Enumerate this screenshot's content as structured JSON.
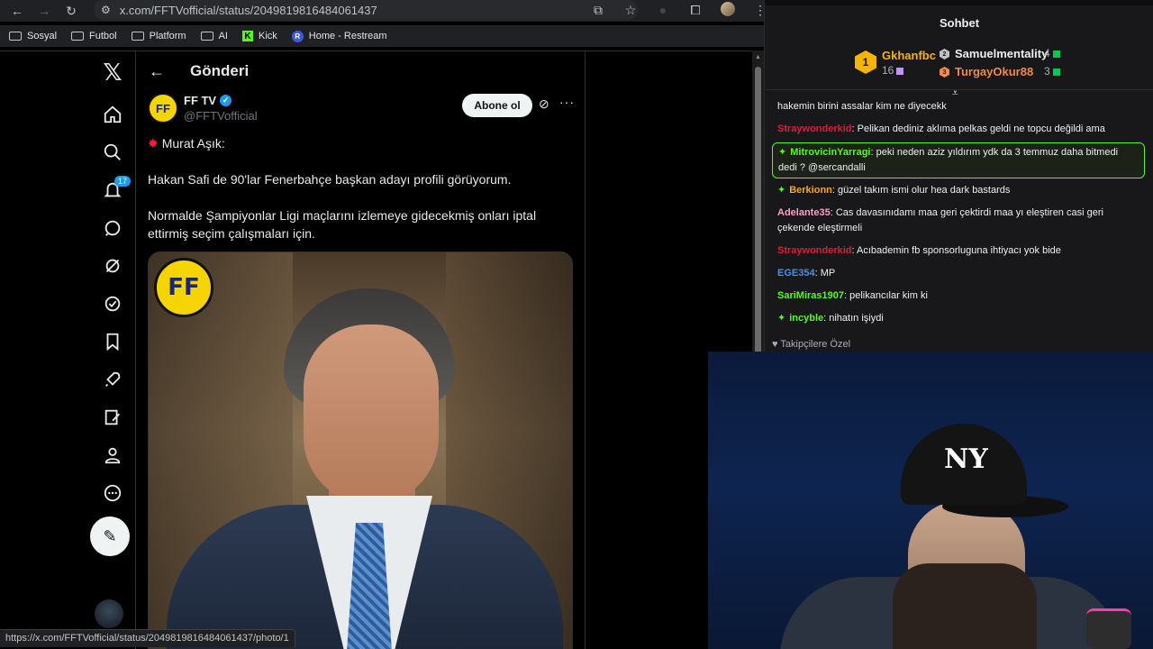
{
  "browser": {
    "url": "x.com/FFTVofficial/status/2049819816484061437",
    "status_url": "https://x.com/FFTVofficial/status/2049819816484061437/photo/1",
    "bookmarks": [
      "Sosyal",
      "Futbol",
      "Platform",
      "AI",
      "Kick",
      "Home - Restream"
    ]
  },
  "x": {
    "header_title": "Gönderi",
    "notification_count": "17",
    "author_name": "FF TV",
    "author_handle": "@FFTVofficial",
    "follow_label": "Abone ol",
    "tweet_line1": "Murat Aşık:",
    "tweet_line2": "Hakan Safi de 90'lar Fenerbahçe başkan adayı profili görüyorum.",
    "tweet_line3": "Normalde Şampiyonlar Ligi maçlarını izlemeye gidecekmiş onları iptal ettirmiş seçim çalışmaları için.",
    "media_logo": "FF"
  },
  "chat": {
    "title": "Sohbet",
    "leaderboard": [
      {
        "rank": "1",
        "name": "Gkhanfbc",
        "count": "16"
      },
      {
        "rank": "2",
        "name": "Samuelmentality",
        "count": "4"
      },
      {
        "rank": "3",
        "name": "TurgayOkur88",
        "count": "3"
      }
    ],
    "messages": [
      {
        "user": "",
        "text": "hakemin birini assalar kim ne diyecekk",
        "color": "#efeff1"
      },
      {
        "user": "Straywonderkid",
        "text": ": Pelikan dediniz aklıma pelkas geldi ne topcu değildi ama",
        "color": "#e01b3c"
      },
      {
        "user": "MitrovicinYarragi",
        "text": ": peki neden aziz yıldırım ydk da 3 temmuz daha bitmedi dedi ? @sercandalli",
        "color": "#53fc18"
      },
      {
        "user": "Berkionn",
        "text": ": güzel takım ismi olur hea dark bastards",
        "color": "#f5a623"
      },
      {
        "user": "Adelante35",
        "text": ": Cas davasınıdamı maa geri çektirdi maa yı eleştiren casi geri çekende eleştirmeli",
        "color": "#ff9ec7"
      },
      {
        "user": "Straywonderkid",
        "text": ": Acıbademin fb sponsorluguna ihtiyacı yok bide",
        "color": "#e01b3c"
      },
      {
        "user": "EGE354",
        "text": ": MP",
        "color": "#4a90e2"
      },
      {
        "user": "SariMiras1907",
        "text": ": pelikancılar kim ki",
        "color": "#53fc18"
      },
      {
        "user": "incyble",
        "text": ": nihatın işiydi",
        "color": "#53fc18"
      }
    ],
    "footer": "Takipçilere Özel"
  },
  "webcam": {
    "cap_logo": "NY"
  }
}
